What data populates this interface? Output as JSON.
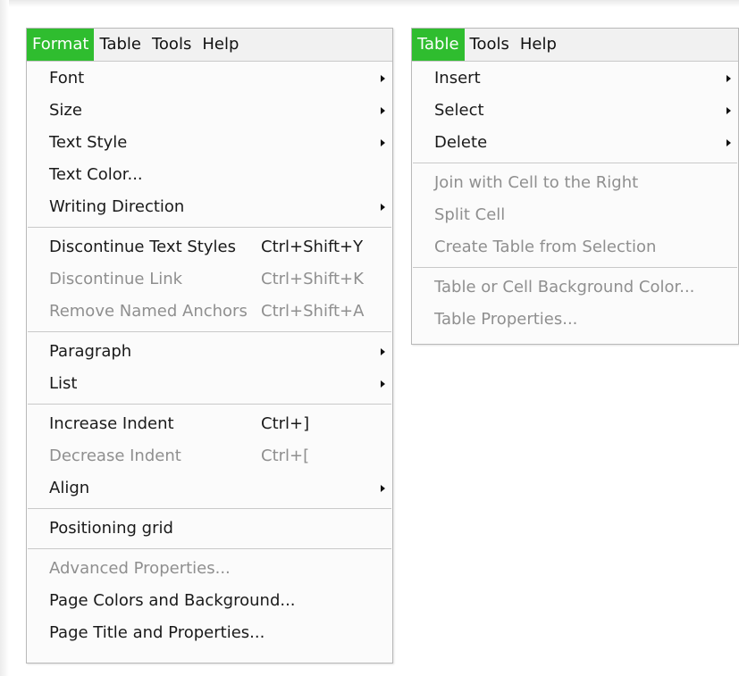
{
  "format_menu": {
    "menubar": [
      "Format",
      "Table",
      "Tools",
      "Help"
    ],
    "groups": [
      [
        {
          "label": "Font",
          "submenu": true,
          "enabled": true
        },
        {
          "label": "Size",
          "submenu": true,
          "enabled": true
        },
        {
          "label": "Text Style",
          "submenu": true,
          "enabled": true
        },
        {
          "label": "Text Color...",
          "submenu": false,
          "enabled": true
        },
        {
          "label": "Writing Direction",
          "submenu": true,
          "enabled": true
        }
      ],
      [
        {
          "label": "Discontinue Text Styles",
          "shortcut": "Ctrl+Shift+Y",
          "enabled": true
        },
        {
          "label": "Discontinue Link",
          "shortcut": "Ctrl+Shift+K",
          "enabled": false
        },
        {
          "label": "Remove Named Anchors",
          "shortcut": "Ctrl+Shift+A",
          "enabled": false
        }
      ],
      [
        {
          "label": "Paragraph",
          "submenu": true,
          "enabled": true
        },
        {
          "label": "List",
          "submenu": true,
          "enabled": true
        }
      ],
      [
        {
          "label": "Increase Indent",
          "shortcut": "Ctrl+]",
          "enabled": true
        },
        {
          "label": "Decrease Indent",
          "shortcut": "Ctrl+[",
          "enabled": false
        },
        {
          "label": "Align",
          "submenu": true,
          "enabled": true
        }
      ],
      [
        {
          "label": "Positioning grid",
          "enabled": true
        }
      ],
      [
        {
          "label": "Advanced Properties...",
          "enabled": false
        },
        {
          "label": "Page Colors and Background...",
          "enabled": true
        },
        {
          "label": "Page Title and Properties...",
          "enabled": true
        }
      ]
    ]
  },
  "table_menu": {
    "menubar": [
      "Table",
      "Tools",
      "Help"
    ],
    "groups": [
      [
        {
          "label": "Insert",
          "submenu": true,
          "enabled": true
        },
        {
          "label": "Select",
          "submenu": true,
          "enabled": true
        },
        {
          "label": "Delete",
          "submenu": true,
          "enabled": true
        }
      ],
      [
        {
          "label": "Join with Cell to the Right",
          "enabled": false
        },
        {
          "label": "Split Cell",
          "enabled": false
        },
        {
          "label": "Create Table from Selection",
          "enabled": false
        }
      ],
      [
        {
          "label": "Table or Cell Background Color...",
          "enabled": false
        },
        {
          "label": "Table Properties...",
          "enabled": false
        }
      ]
    ]
  },
  "colors": {
    "active_menu_bg": "#2fbd2f",
    "disabled_text": "#8f8f8f"
  }
}
